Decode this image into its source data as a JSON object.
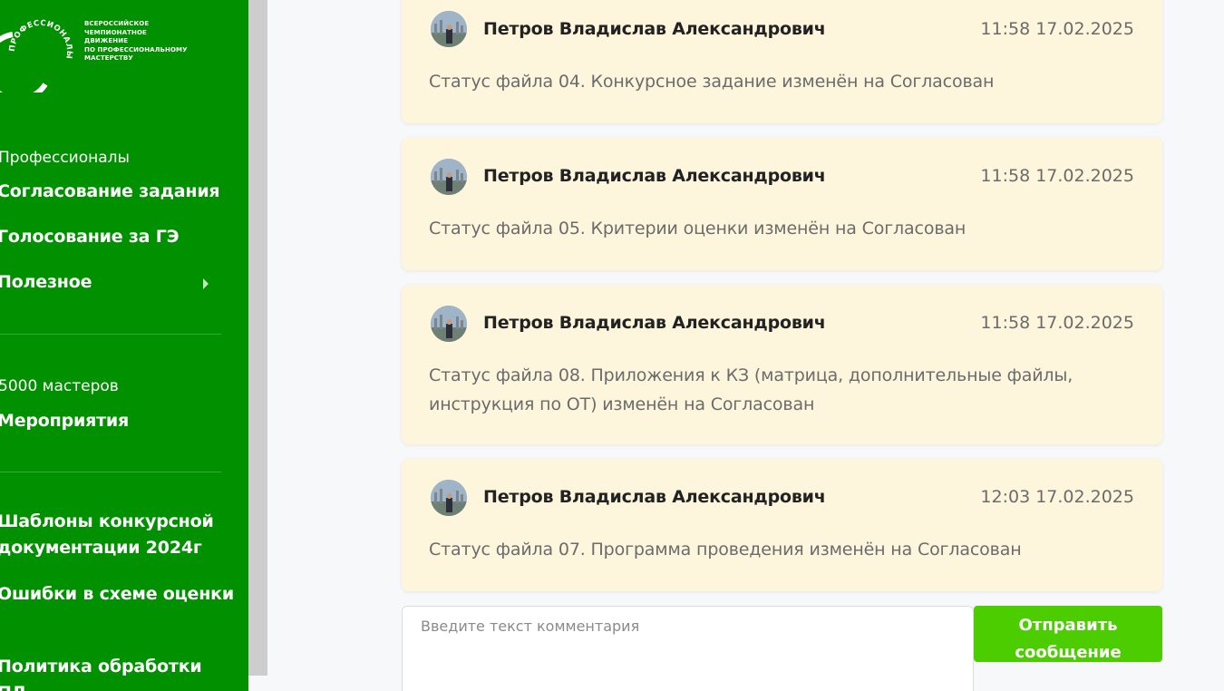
{
  "logo": {
    "ring_text": "ПРОФЕССИОНАЛЫ",
    "lines": [
      "ВСЕРОССИЙСКОЕ",
      "ЧЕМПИОНАТНОЕ",
      "ДВИЖЕНИЕ",
      "ПО ПРОФЕССИОНАЛЬНОМУ",
      "МАСТЕРСТВУ"
    ]
  },
  "sidebar": {
    "group1_title": "Профессионалы",
    "approval": "Согласование задания",
    "vote": "Голосование за ГЭ",
    "useful": "Полезное",
    "group2_title": "5000 мастеров",
    "events": "Мероприятия",
    "templates": "Шаблоны конкурсной документации 2024г",
    "errors": "Ошибки в схеме оценки",
    "policy": "Политика обработки ПД"
  },
  "feed": [
    {
      "author": "Петров Владислав Александрович",
      "time": "11:58 17.02.2025",
      "text": "Статус файла 04. Конкурсное задание изменён на Согласован"
    },
    {
      "author": "Петров Владислав Александрович",
      "time": "11:58 17.02.2025",
      "text": "Статус файла 05. Критерии оценки изменён на Согласован"
    },
    {
      "author": "Петров Владислав Александрович",
      "time": "11:58 17.02.2025",
      "text": "Статус файла 08. Приложения к КЗ (матрица, дополнительные файлы, инструкция по ОТ) изменён на Согласован"
    },
    {
      "author": "Петров Владислав Александрович",
      "time": "12:03 17.02.2025",
      "text": "Статус файла 07. Программа проведения изменён на Согласован"
    }
  ],
  "comment": {
    "placeholder": "Введите текст комментария",
    "send_label": "Отправить сообщение"
  },
  "colors": {
    "sidebar_bg": "#009000",
    "card_bg": "#fef6dc",
    "send_button": "#4ccd00"
  }
}
